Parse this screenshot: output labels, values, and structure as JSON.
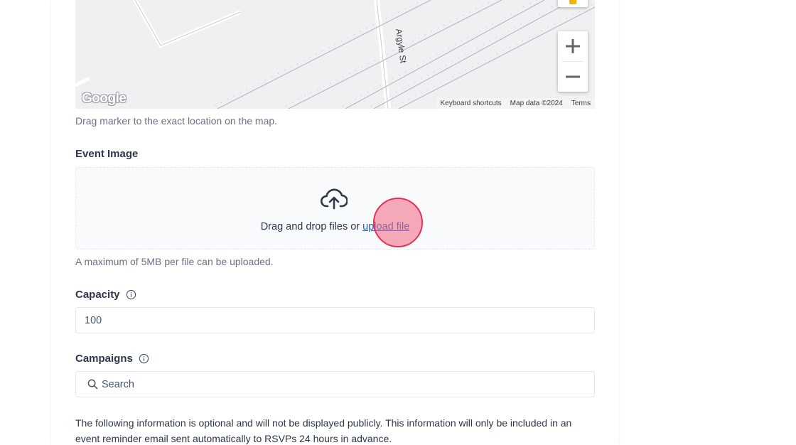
{
  "map": {
    "street_label": "Argyle St",
    "logo_text": "Google",
    "footer": {
      "keyboard_shortcuts": "Keyboard shortcuts",
      "map_data": "Map data ©2024",
      "terms": "Terms"
    },
    "zoom_in": "+",
    "zoom_out": "−",
    "helper": "Drag marker to the exact location on the map."
  },
  "event_image": {
    "label": "Event Image",
    "drop_text": "Drag and drop files or",
    "upload_link": "upload file",
    "helper": "A maximum of 5MB per file can be uploaded."
  },
  "capacity": {
    "label": "Capacity",
    "value": "100"
  },
  "campaigns": {
    "label": "Campaigns",
    "placeholder": "Search"
  },
  "optional_note": "The following information is optional and will not be displayed publicly. This information will only be included in an event reminder email sent automatically to RSVPs 24 hours in advance.",
  "colors": {
    "link": "#2b5fab",
    "click_marker": "#e0325a"
  }
}
